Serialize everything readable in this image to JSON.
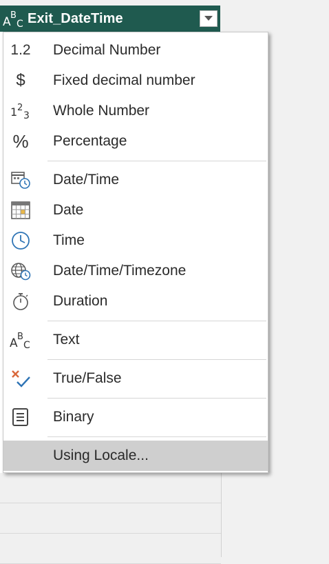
{
  "column": {
    "title": "Exit_DateTime",
    "type_icon": "text-type-icon",
    "dropdown_icon": "chevron-down-icon"
  },
  "menu": {
    "groups": [
      [
        {
          "label": "Decimal Number",
          "icon": "decimal-number-icon",
          "glyph": "1.2"
        },
        {
          "label": "Fixed decimal number",
          "icon": "currency-icon",
          "glyph": "$"
        },
        {
          "label": "Whole Number",
          "icon": "whole-number-icon",
          "glyph": "123"
        },
        {
          "label": "Percentage",
          "icon": "percentage-icon",
          "glyph": "%"
        }
      ],
      [
        {
          "label": "Date/Time",
          "icon": "datetime-icon"
        },
        {
          "label": "Date",
          "icon": "calendar-icon"
        },
        {
          "label": "Time",
          "icon": "clock-icon"
        },
        {
          "label": "Date/Time/Timezone",
          "icon": "globe-clock-icon"
        },
        {
          "label": "Duration",
          "icon": "stopwatch-icon"
        }
      ],
      [
        {
          "label": "Text",
          "icon": "text-type-icon"
        }
      ],
      [
        {
          "label": "True/False",
          "icon": "true-false-icon"
        }
      ],
      [
        {
          "label": "Binary",
          "icon": "binary-icon"
        }
      ],
      [
        {
          "label": "Using Locale...",
          "icon": "",
          "highlighted": true
        }
      ]
    ]
  },
  "colors": {
    "header_bg": "#1f5a4f",
    "hover_bg": "#cfcfcf",
    "true_false_x": "#d9673a",
    "true_false_check": "#2e74b5"
  }
}
